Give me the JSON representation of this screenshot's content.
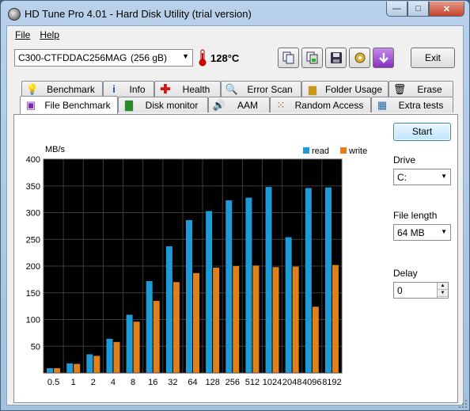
{
  "window": {
    "title": "HD Tune Pro 4.01 - Hard Disk Utility (trial version)",
    "controls": {
      "minimize": "—",
      "maximize": "□",
      "close": "✕"
    }
  },
  "menu": {
    "file": "File",
    "help": "Help"
  },
  "toolbar": {
    "drive_model": "C300-CTFDDAC256MAG",
    "drive_size": "(256 gB)",
    "temperature": "128°C",
    "exit_label": "Exit",
    "icons": [
      "copy-info-icon",
      "copy-screenshot-icon",
      "save-icon",
      "options-icon",
      "download-icon"
    ]
  },
  "tabs_row1": [
    {
      "label": "Benchmark",
      "icon": "benchmark-icon"
    },
    {
      "label": "Info",
      "icon": "info-icon"
    },
    {
      "label": "Health",
      "icon": "health-icon"
    },
    {
      "label": "Error Scan",
      "icon": "error-scan-icon"
    },
    {
      "label": "Folder Usage",
      "icon": "folder-usage-icon"
    },
    {
      "label": "Erase",
      "icon": "erase-icon"
    }
  ],
  "tabs_row2": [
    {
      "label": "File Benchmark",
      "icon": "file-benchmark-icon",
      "active": true
    },
    {
      "label": "Disk monitor",
      "icon": "disk-monitor-icon"
    },
    {
      "label": "AAM",
      "icon": "aam-icon"
    },
    {
      "label": "Random Access",
      "icon": "random-access-icon"
    },
    {
      "label": "Extra tests",
      "icon": "extra-tests-icon"
    }
  ],
  "side_panel": {
    "start_label": "Start",
    "drive_label": "Drive",
    "drive_value": "C:",
    "file_length_label": "File length",
    "file_length_value": "64 MB",
    "delay_label": "Delay",
    "delay_value": "0"
  },
  "colors": {
    "read": "#1e9ad6",
    "write": "#e0801a",
    "plot_bg": "#000000",
    "grid": "#3c3c3c"
  },
  "chart_data": {
    "type": "bar",
    "ylabel": "MB/s",
    "ylim": [
      0,
      400
    ],
    "yticks": [
      50,
      100,
      150,
      200,
      250,
      300,
      350,
      400
    ],
    "categories": [
      "0.5",
      "1",
      "2",
      "4",
      "8",
      "16",
      "32",
      "64",
      "128",
      "256",
      "512",
      "1024",
      "2048",
      "4096",
      "8192"
    ],
    "series": [
      {
        "name": "read",
        "values": [
          9,
          18,
          35,
          64,
          109,
          172,
          237,
          286,
          303,
          323,
          328,
          348,
          254,
          346,
          347
        ]
      },
      {
        "name": "write",
        "values": [
          9,
          17,
          32,
          58,
          96,
          135,
          170,
          187,
          197,
          200,
          201,
          198,
          199,
          124,
          202
        ]
      }
    ],
    "legend_position": "top-right"
  }
}
